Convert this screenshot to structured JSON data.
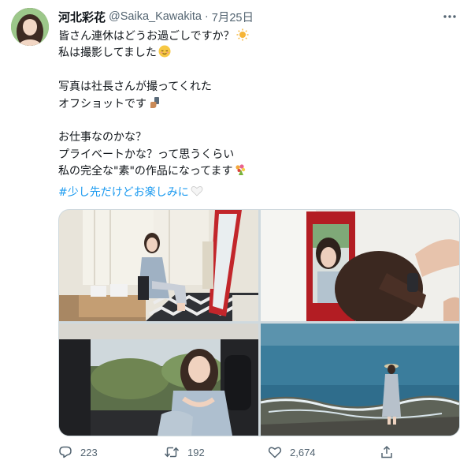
{
  "user": {
    "display_name": "河北彩花",
    "handle": "@Saika_Kawakita",
    "dot": "·",
    "date": "7月25日"
  },
  "tweet": {
    "lines": [
      "皆さん連休はどうお過ごしですか？",
      "私は撮影してました",
      "",
      "写真は社長さんが撮ってくれた",
      "オフショットです",
      "",
      "お仕事なのかな？",
      "プライベートかな？って思うくらい",
      "私の完全な\"素\"の作品になってます"
    ],
    "hashtag": "#少し先だけどお楽しみに"
  },
  "icons": {
    "more": "more-horizontal-icon",
    "reply": "reply-icon",
    "retweet": "retweet-icon",
    "like": "heart-icon",
    "share": "share-icon"
  },
  "stats": {
    "replies": "223",
    "retweets": "192",
    "likes": "2,674"
  },
  "colors": {
    "link": "#1d9bf0",
    "secondary_text": "#536471",
    "border": "#cfd9de"
  }
}
